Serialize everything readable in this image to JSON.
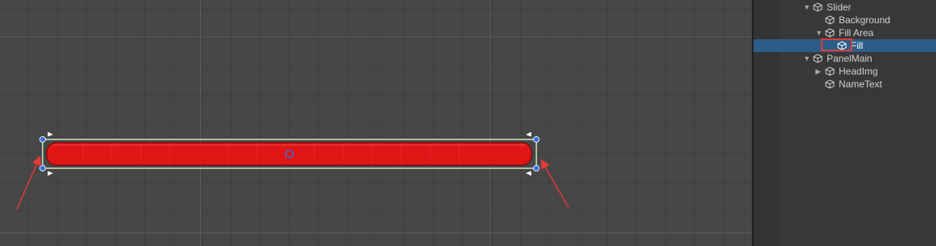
{
  "scene_view": {
    "slider": {
      "fill_color": "#e01515",
      "frame_color": "#cfe6c0",
      "handle_color": "#2f6fd4"
    },
    "annotation_color": "#e03a3a"
  },
  "hierarchy": {
    "items": [
      {
        "label": "Slider",
        "expanded": true,
        "has_children": true
      },
      {
        "label": "Background",
        "expanded": false,
        "has_children": false
      },
      {
        "label": "Fill Area",
        "expanded": true,
        "has_children": true
      },
      {
        "label": "Fill",
        "expanded": false,
        "has_children": false,
        "selected": true,
        "highlighted": true
      },
      {
        "label": "PanelMain",
        "expanded": true,
        "has_children": true
      },
      {
        "label": "HeadImg",
        "expanded": false,
        "has_children": true
      },
      {
        "label": "NameText",
        "expanded": false,
        "has_children": false
      }
    ],
    "icon": "gameobject-cube-icon",
    "selection_color": "#2c5d87"
  }
}
